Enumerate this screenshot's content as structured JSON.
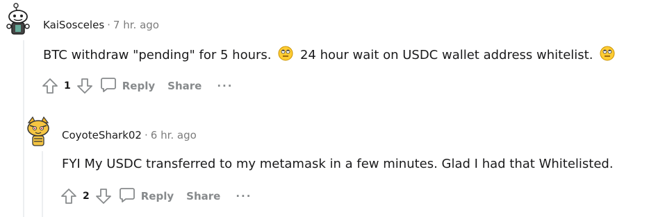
{
  "comments": [
    {
      "username": "KaiSosceles",
      "separator": "·",
      "time": "7 hr. ago",
      "text_part1": "BTC withdraw \"pending\" for 5 hours.",
      "text_part2": "24 hour wait on USDC wallet address whitelist.",
      "emoji": "eye-roll-emoji",
      "votes": "1",
      "reply_label": "Reply",
      "share_label": "Share",
      "more_label": "···"
    },
    {
      "username": "CoyoteShark02",
      "separator": "·",
      "time": "6 hr. ago",
      "text": "FYI My USDC transferred to my metamask in a few minutes. Glad I had that Whitelisted.",
      "votes": "2",
      "reply_label": "Reply",
      "share_label": "Share",
      "more_label": "···"
    }
  ],
  "colors": {
    "meta_gray": "#7c7c7c",
    "action_gray": "#878a8c",
    "thread_line": "#edeff1"
  }
}
